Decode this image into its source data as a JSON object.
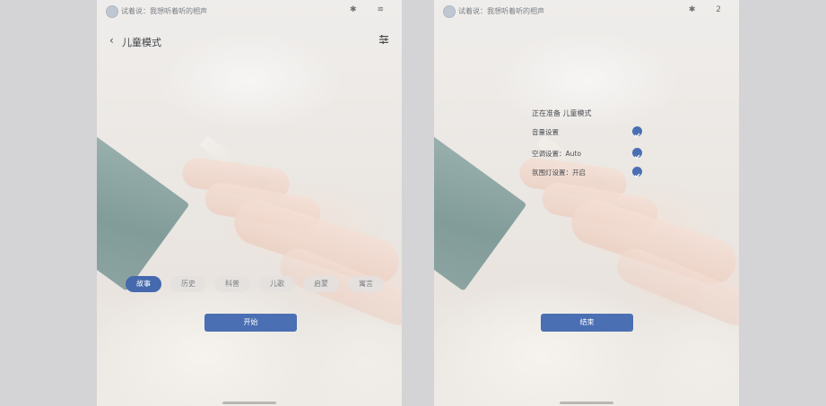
{
  "left_panel": {
    "status_bar": {
      "text": "试着说：我想听着听的相声",
      "icons": "✱ ≋"
    },
    "header": {
      "title": "儿童模式"
    },
    "chips": [
      "故事",
      "历史",
      "科普",
      "儿歌",
      "启蒙",
      "寓言"
    ],
    "active_chip_index": 0,
    "start_button": "开始"
  },
  "right_panel": {
    "status_bar": {
      "text": "试着说：我想听着听的相声",
      "icons": "✱ 2"
    },
    "preparing_text": "正在准备 儿童模式",
    "items": [
      {
        "label": "音量设置",
        "done": true
      },
      {
        "label": "空调设置：Auto",
        "done": true
      },
      {
        "label": "氛围灯设置：开启",
        "done": true
      }
    ],
    "end_button": "结束"
  },
  "colors": {
    "accent": "#4a6fb3",
    "active_chip": "#4569ad"
  }
}
